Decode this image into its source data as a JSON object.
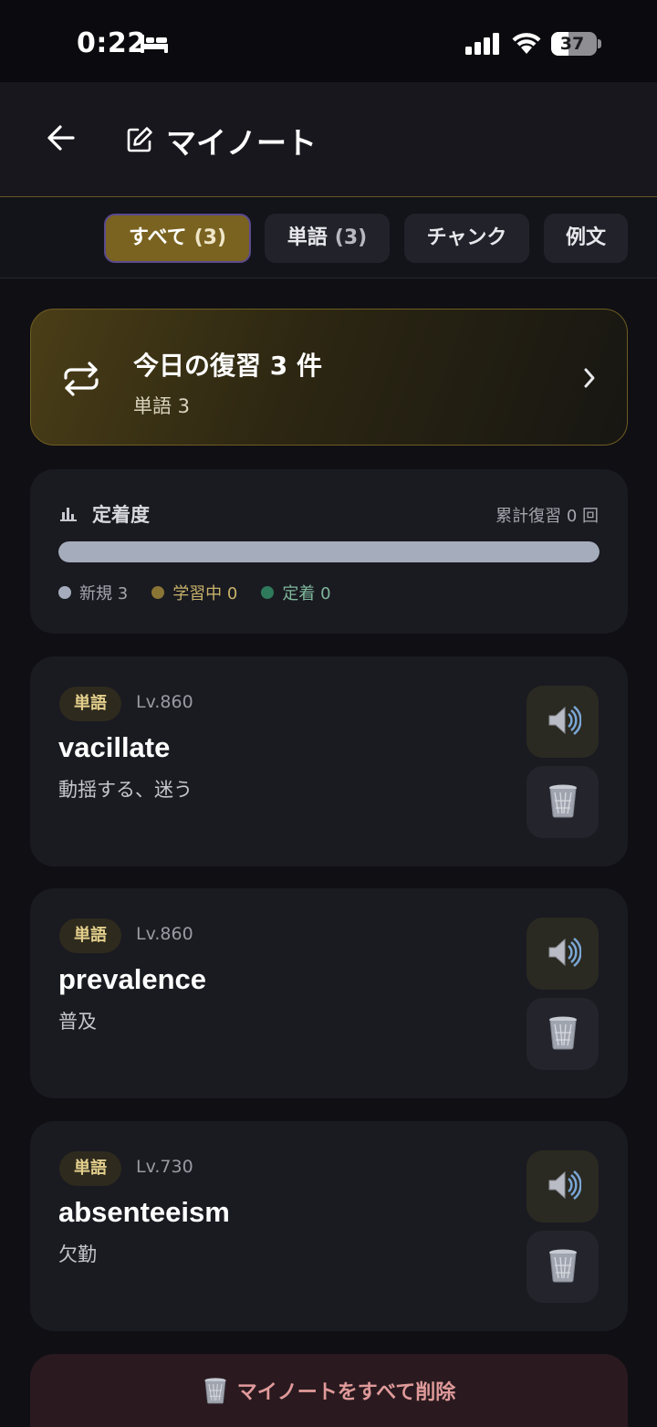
{
  "status_bar": {
    "time": "0:22",
    "battery": "37",
    "battery_fraction": 0.37
  },
  "header": {
    "title": "マイノート"
  },
  "tabs": [
    {
      "label": "すべて",
      "count": "(3)",
      "active": true
    },
    {
      "label": "単語",
      "count": "(3)",
      "active": false
    },
    {
      "label": "チャンク",
      "count": "",
      "active": false
    },
    {
      "label": "例文",
      "count": "",
      "active": false
    }
  ],
  "review": {
    "title": "今日の復習 3 件",
    "subtitle": "単語 3"
  },
  "retention": {
    "title": "定着度",
    "total": "累計復習 0 回",
    "progress_fraction": 1.0,
    "legend": [
      {
        "label": "新規 3",
        "color": "#a5adbc"
      },
      {
        "label": "学習中 0",
        "color": "#8a7535"
      },
      {
        "label": "定着 0",
        "color": "#2f7a5c"
      }
    ]
  },
  "words": [
    {
      "tag": "単語",
      "level": "Lv.860",
      "term": "vacillate",
      "meaning": "動揺する、迷う"
    },
    {
      "tag": "単語",
      "level": "Lv.860",
      "term": "prevalence",
      "meaning": "普及"
    },
    {
      "tag": "単語",
      "level": "Lv.730",
      "term": "absenteeism",
      "meaning": "欠勤"
    }
  ],
  "delete_all": {
    "label": "マイノートをすべて削除"
  },
  "colors": {
    "accent": "#7a6320",
    "background": "#0f0f14",
    "card": "#1a1a21",
    "danger_text": "#e09a9a"
  }
}
